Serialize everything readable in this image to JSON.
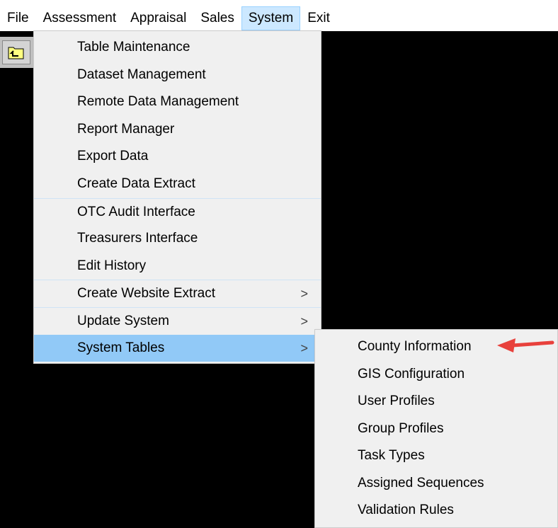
{
  "menubar": [
    "File",
    "Assessment",
    "Appraisal",
    "Sales",
    "System",
    "Exit"
  ],
  "system_menu": [
    {
      "label": "Table Maintenance"
    },
    {
      "label": "Dataset Management"
    },
    {
      "label": "Remote Data Management"
    },
    {
      "label": "Report Manager"
    },
    {
      "label": "Export Data"
    },
    {
      "label": "Create Data Extract"
    },
    {
      "label": "OTC Audit Interface"
    },
    {
      "label": "Treasurers Interface"
    },
    {
      "label": "Edit History"
    },
    {
      "label": "Create Website Extract",
      "submenu": ">"
    },
    {
      "label": "Update System",
      "submenu": ">"
    },
    {
      "label": "System Tables",
      "submenu": ">"
    }
  ],
  "system_tables_submenu": [
    "County Information",
    "GIS Configuration",
    "User Profiles",
    "Group Profiles",
    "Task Types",
    "Assigned Sequences",
    "Validation Rules"
  ],
  "colors": {
    "highlight": "#91c9f7",
    "annotation_arrow": "#e8413c"
  }
}
